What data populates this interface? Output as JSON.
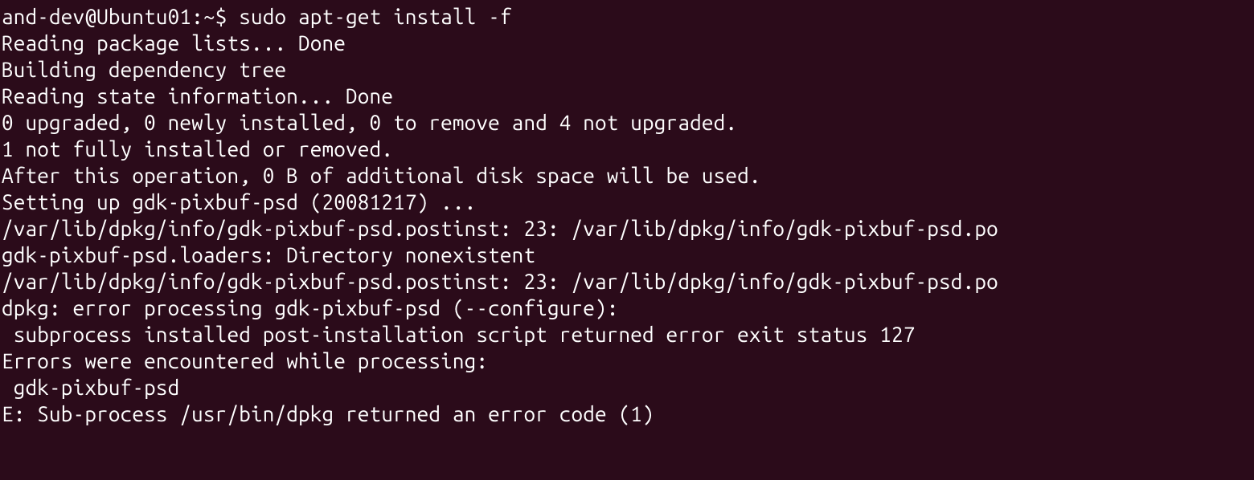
{
  "prompt": {
    "user_host": "and-dev@Ubuntu01",
    "separator": ":",
    "path": "~",
    "dollar": "$"
  },
  "command": "sudo apt-get install -f",
  "output": {
    "l1": "Reading package lists... Done",
    "l2": "Building dependency tree",
    "l3": "Reading state information... Done",
    "l4": "0 upgraded, 0 newly installed, 0 to remove and 4 not upgraded.",
    "l5": "1 not fully installed or removed.",
    "l6": "After this operation, 0 B of additional disk space will be used.",
    "l7": "Setting up gdk-pixbuf-psd (20081217) ...",
    "l8": "/var/lib/dpkg/info/gdk-pixbuf-psd.postinst: 23: /var/lib/dpkg/info/gdk-pixbuf-psd.po",
    "l9": "gdk-pixbuf-psd.loaders: Directory nonexistent",
    "l10": "/var/lib/dpkg/info/gdk-pixbuf-psd.postinst: 23: /var/lib/dpkg/info/gdk-pixbuf-psd.po",
    "l11": "dpkg: error processing gdk-pixbuf-psd (--configure):",
    "l12": " subprocess installed post-installation script returned error exit status 127",
    "l13": "Errors were encountered while processing:",
    "l14": " gdk-pixbuf-psd",
    "l15": "E: Sub-process /usr/bin/dpkg returned an error code (1)"
  }
}
